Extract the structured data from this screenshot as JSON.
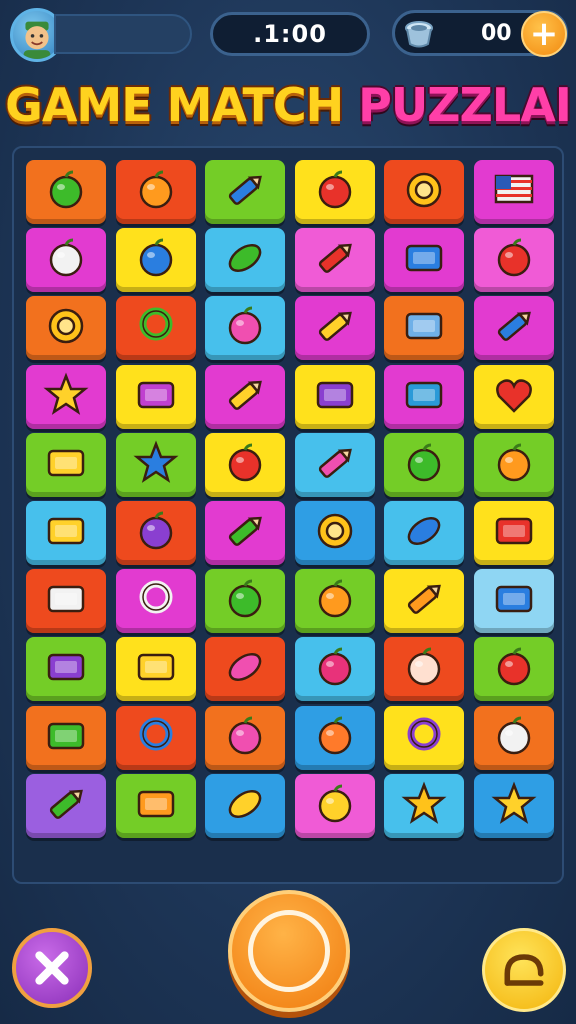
{
  "hud": {
    "timer": ".1:00",
    "coin_count": "00",
    "add_label": "+"
  },
  "title": {
    "part1": "GAME MATCH",
    "part2": "PUZZLAI"
  },
  "colors": {
    "orange": "#f2711e",
    "red": "#ee4a1e",
    "green": "#74cd27",
    "yellow": "#ffe11c",
    "magenta": "#e23bd0",
    "pink": "#f05bd6",
    "cyan": "#47c0ec",
    "blue": "#2f9ee4",
    "purple": "#9b5fe0",
    "lightblue": "#8fd6f3"
  },
  "board": [
    [
      {
        "bg": "orange",
        "icon": "green-balloon-icon"
      },
      {
        "bg": "red",
        "icon": "orange-fruit-icon"
      },
      {
        "bg": "green",
        "icon": "blue-crayon-icon"
      },
      {
        "bg": "yellow",
        "icon": "red-apple-icon"
      },
      {
        "bg": "red",
        "icon": "sun-icon"
      },
      {
        "bg": "magenta",
        "icon": "usa-flag-icon"
      }
    ],
    [
      {
        "bg": "magenta",
        "icon": "flower-pot-icon"
      },
      {
        "bg": "yellow",
        "icon": "blue-ball-icon"
      },
      {
        "bg": "cyan",
        "icon": "green-leaf-icon"
      },
      {
        "bg": "pink",
        "icon": "red-crayon-icon"
      },
      {
        "bg": "magenta",
        "icon": "blue-tag-icon"
      },
      {
        "bg": "pink",
        "icon": "red-snail-icon"
      }
    ],
    [
      {
        "bg": "orange",
        "icon": "sunflower-icon"
      },
      {
        "bg": "red",
        "icon": "green-ring-icon"
      },
      {
        "bg": "cyan",
        "icon": "pink-apple-icon"
      },
      {
        "bg": "magenta",
        "icon": "yellow-pencil-icon"
      },
      {
        "bg": "orange",
        "icon": "phone-icon"
      },
      {
        "bg": "magenta",
        "icon": "blue-pencil-icon"
      }
    ],
    [
      {
        "bg": "magenta",
        "icon": "yellow-star-icon"
      },
      {
        "bg": "yellow",
        "icon": "camera-icon"
      },
      {
        "bg": "magenta",
        "icon": "yellow-crayon-icon"
      },
      {
        "bg": "yellow",
        "icon": "purple-block-icon"
      },
      {
        "bg": "magenta",
        "icon": "envelope-icon"
      },
      {
        "bg": "yellow",
        "icon": "red-heart-icon"
      }
    ],
    [
      {
        "bg": "green",
        "icon": "yellow-eraser-icon"
      },
      {
        "bg": "green",
        "icon": "blue-star-icon"
      },
      {
        "bg": "yellow",
        "icon": "red-lollipop-icon"
      },
      {
        "bg": "cyan",
        "icon": "pink-pencil-icon"
      },
      {
        "bg": "green",
        "icon": "green-apple-icon"
      },
      {
        "bg": "green",
        "icon": "orange-bird-icon"
      }
    ],
    [
      {
        "bg": "cyan",
        "icon": "yellow-battery-icon"
      },
      {
        "bg": "red",
        "icon": "purple-ball-icon"
      },
      {
        "bg": "magenta",
        "icon": "green-marker-icon"
      },
      {
        "bg": "blue",
        "icon": "sun-gear-icon"
      },
      {
        "bg": "cyan",
        "icon": "blue-leaf-icon"
      },
      {
        "bg": "yellow",
        "icon": "red-truck-icon"
      }
    ],
    [
      {
        "bg": "red",
        "icon": "tape-icon"
      },
      {
        "bg": "magenta",
        "icon": "magnifier-icon"
      },
      {
        "bg": "green",
        "icon": "green-apple-2-icon"
      },
      {
        "bg": "green",
        "icon": "orange-apple-icon"
      },
      {
        "bg": "yellow",
        "icon": "orange-pencil-icon"
      },
      {
        "bg": "lightblue",
        "icon": "blue-book-icon"
      }
    ],
    [
      {
        "bg": "green",
        "icon": "purple-box-icon"
      },
      {
        "bg": "yellow",
        "icon": "yellow-roll-icon"
      },
      {
        "bg": "red",
        "icon": "pink-bean-icon"
      },
      {
        "bg": "cyan",
        "icon": "radish-icon"
      },
      {
        "bg": "red",
        "icon": "eye-icon"
      },
      {
        "bg": "green",
        "icon": "red-cloud-icon"
      }
    ],
    [
      {
        "bg": "orange",
        "icon": "green-card-icon"
      },
      {
        "bg": "red",
        "icon": "blue-ring-icon"
      },
      {
        "bg": "orange",
        "icon": "pink-face-icon"
      },
      {
        "bg": "blue",
        "icon": "ufo-icon"
      },
      {
        "bg": "yellow",
        "icon": "purple-ring-icon"
      },
      {
        "bg": "orange",
        "icon": "white-bag-icon"
      }
    ],
    [
      {
        "bg": "purple",
        "icon": "green-crayon-icon"
      },
      {
        "bg": "green",
        "icon": "orange-eraser-icon"
      },
      {
        "bg": "blue",
        "icon": "yellow-lemon-icon"
      },
      {
        "bg": "pink",
        "icon": "yellow-hat-icon"
      },
      {
        "bg": "cyan",
        "icon": "gold-star-icon"
      },
      {
        "bg": "blue",
        "icon": "star-bird-icon"
      }
    ]
  ],
  "buttons": {
    "close": "close-icon",
    "main": "start-ring-icon",
    "exit": "exit-icon"
  }
}
